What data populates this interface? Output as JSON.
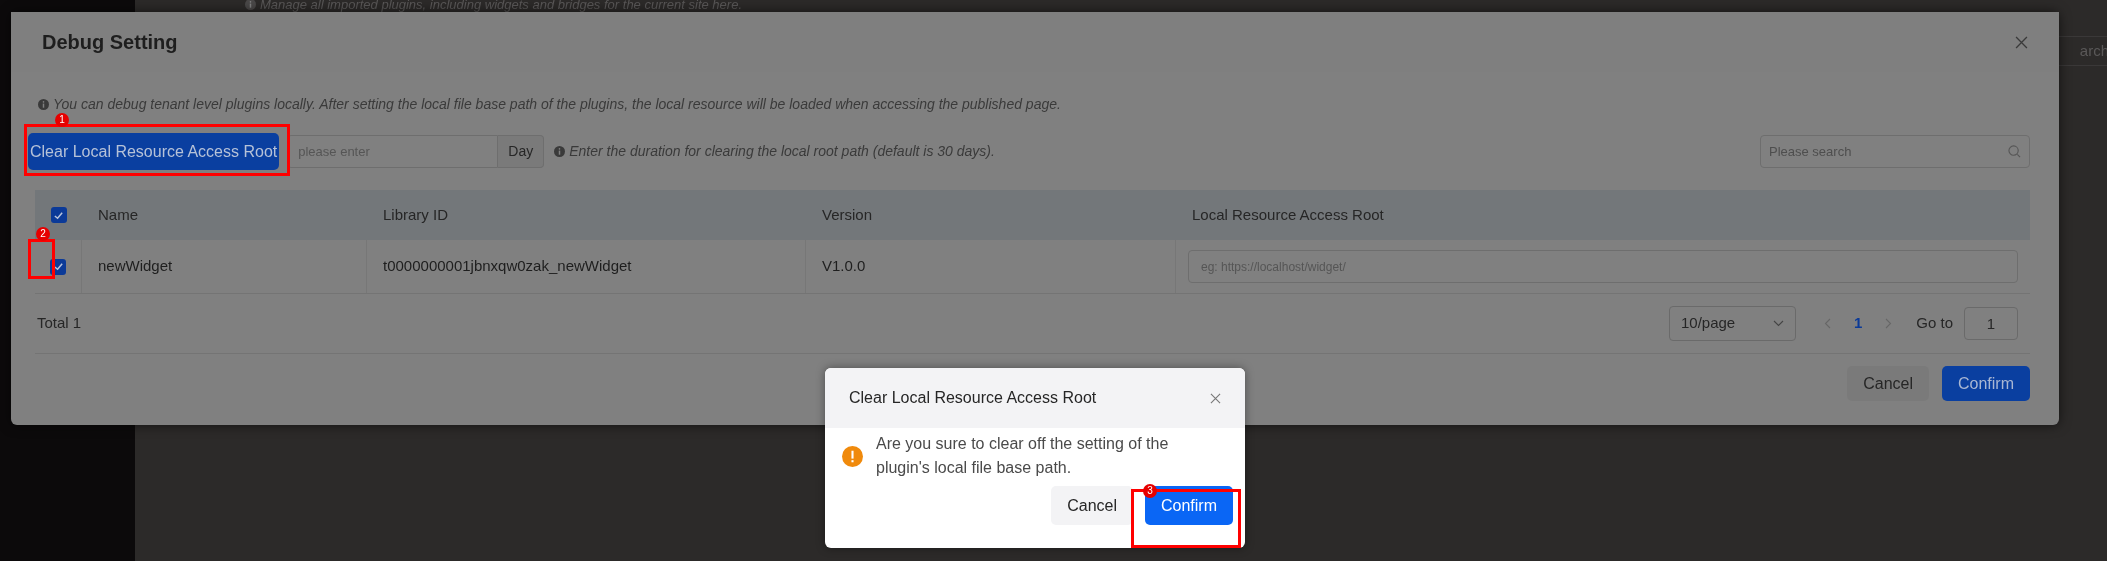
{
  "background": {
    "notice": "Manage all imported plugins, including widgets and bridges for the current site here.",
    "search_fragment": "arch"
  },
  "dialog": {
    "title": "Debug Setting",
    "notice": "You can debug tenant level plugins locally. After setting the local file base path of the plugins, the local resource will be loaded when accessing the published page.",
    "clear_button": "Clear Local Resource Access Root",
    "duration_field": {
      "placeholder": "please enter",
      "unit": "Day"
    },
    "duration_hint": "Enter the duration for clearing the local root path (default is 30 days).",
    "search": {
      "placeholder": "Please search"
    },
    "table": {
      "all_checked": true,
      "columns": [
        "Name",
        "Library ID",
        "Version",
        "Local Resource Access Root"
      ],
      "rows": [
        {
          "checked": true,
          "name": "newWidget",
          "library_id": "t0000000001jbnxqw0zak_newWidget",
          "version": "V1.0.0",
          "root": {
            "placeholder": "eg: https://localhost/widget/"
          }
        }
      ]
    },
    "total": "Total 1",
    "page_size": "10/page",
    "pages": [
      {
        "label": "1",
        "selected": true
      }
    ],
    "goto_label": "Go to",
    "goto_value": "1",
    "buttons": [
      "Cancel",
      "Confirm"
    ]
  },
  "confirm_popup": {
    "title": "Clear Local Resource Access Root",
    "message": "Are you sure to clear off the setting of the plugin's local file base path.",
    "buttons": [
      "Cancel",
      "Confirm"
    ]
  },
  "annotations": [
    {
      "number": "1"
    },
    {
      "number": "2"
    },
    {
      "number": "3"
    }
  ]
}
